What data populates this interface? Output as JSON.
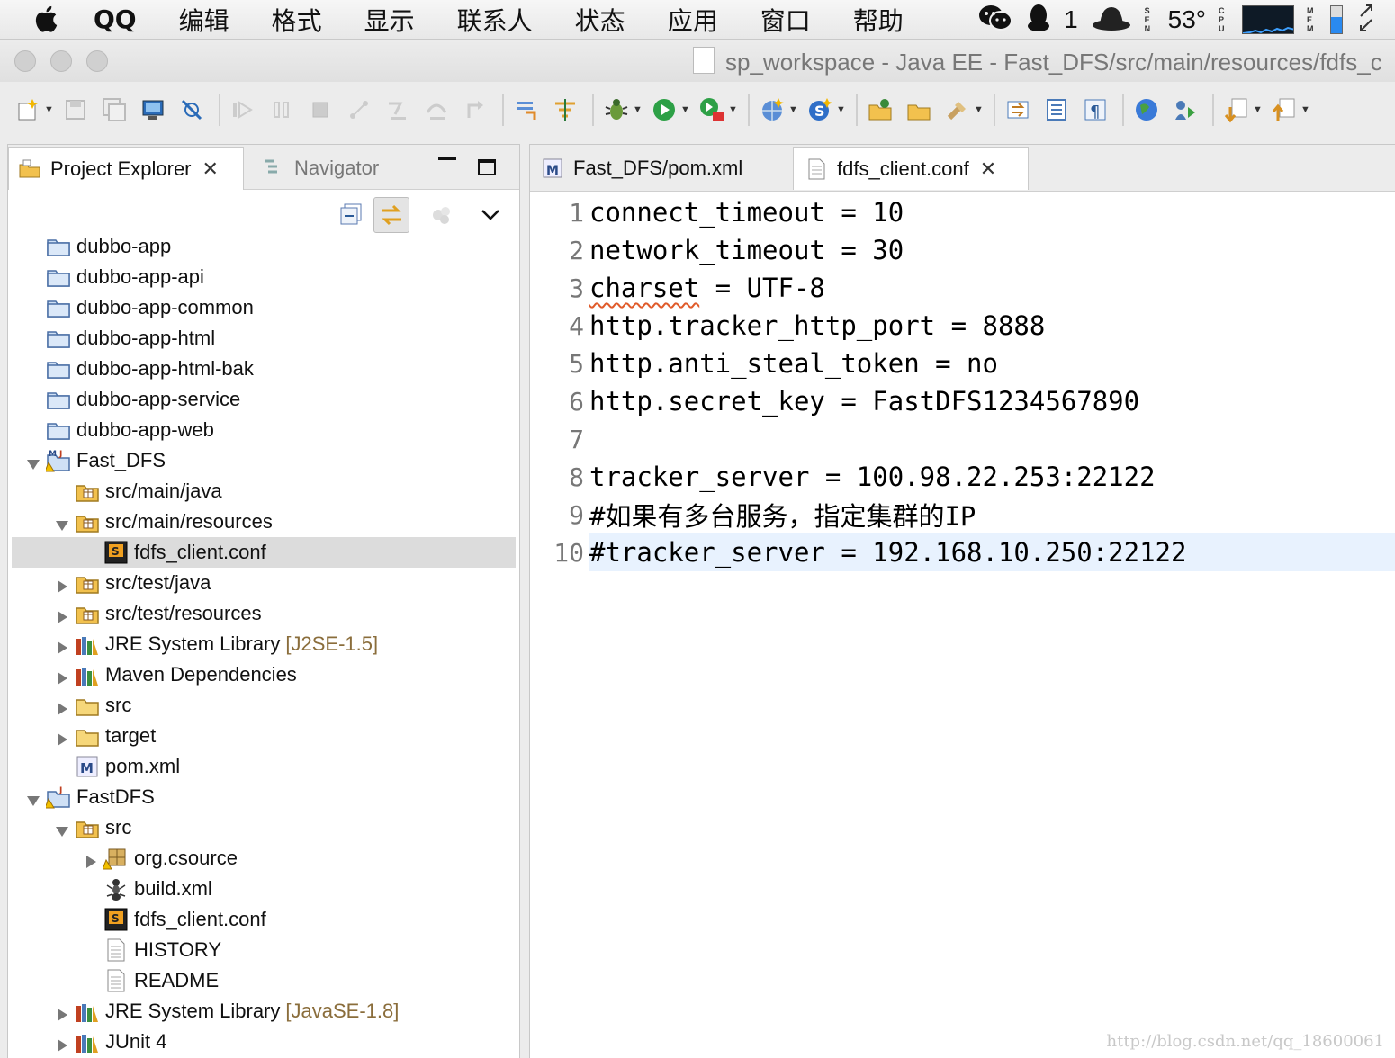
{
  "menubar": {
    "app_name": "QQ",
    "items": [
      "编辑",
      "格式",
      "显示",
      "联系人",
      "状态",
      "应用",
      "窗口",
      "帮助"
    ],
    "qq_count": "1",
    "temperature": "53°",
    "sensor_labels": {
      "sen": "S E N",
      "cpu": "C P U",
      "mem": "M E M"
    },
    "memory_usage": 0.6
  },
  "window": {
    "title": "sp_workspace - Java EE - Fast_DFS/src/main/resources/fdfs_c"
  },
  "explorer": {
    "tabs": [
      {
        "label": "Project Explorer",
        "active": true
      },
      {
        "label": "Navigator",
        "active": false
      }
    ],
    "tree": [
      {
        "label": "dubbo-app",
        "level": 0,
        "twisty": "none",
        "icon": "project-folder-icon"
      },
      {
        "label": "dubbo-app-api",
        "level": 0,
        "twisty": "none",
        "icon": "project-folder-icon"
      },
      {
        "label": "dubbo-app-common",
        "level": 0,
        "twisty": "none",
        "icon": "project-folder-icon"
      },
      {
        "label": "dubbo-app-html",
        "level": 0,
        "twisty": "none",
        "icon": "project-folder-icon"
      },
      {
        "label": "dubbo-app-html-bak",
        "level": 0,
        "twisty": "none",
        "icon": "project-folder-icon"
      },
      {
        "label": "dubbo-app-service",
        "level": 0,
        "twisty": "none",
        "icon": "project-folder-icon"
      },
      {
        "label": "dubbo-app-web",
        "level": 0,
        "twisty": "none",
        "icon": "project-folder-icon"
      },
      {
        "label": "Fast_DFS",
        "level": 0,
        "twisty": "open",
        "icon": "maven-project-icon"
      },
      {
        "label": "src/main/java",
        "level": 1,
        "twisty": "none",
        "icon": "source-folder-icon"
      },
      {
        "label": "src/main/resources",
        "level": 1,
        "twisty": "open",
        "icon": "source-folder-icon"
      },
      {
        "label": "fdfs_client.conf",
        "level": 2,
        "twisty": "none",
        "icon": "conf-file-icon",
        "selected": true
      },
      {
        "label": "src/test/java",
        "level": 1,
        "twisty": "closed",
        "icon": "source-folder-icon"
      },
      {
        "label": "src/test/resources",
        "level": 1,
        "twisty": "closed",
        "icon": "source-folder-icon"
      },
      {
        "label": "JRE System Library",
        "decor": "[J2SE-1.5]",
        "level": 1,
        "twisty": "closed",
        "icon": "library-icon"
      },
      {
        "label": "Maven Dependencies",
        "level": 1,
        "twisty": "closed",
        "icon": "library-icon"
      },
      {
        "label": "src",
        "level": 1,
        "twisty": "closed",
        "icon": "folder-icon"
      },
      {
        "label": "target",
        "level": 1,
        "twisty": "closed",
        "icon": "folder-icon"
      },
      {
        "label": "pom.xml",
        "level": 1,
        "twisty": "none",
        "icon": "maven-file-icon"
      },
      {
        "label": "FastDFS",
        "level": 0,
        "twisty": "open",
        "icon": "java-project-icon"
      },
      {
        "label": "src",
        "level": 1,
        "twisty": "open",
        "icon": "source-folder-icon"
      },
      {
        "label": "org.csource",
        "level": 2,
        "twisty": "closed",
        "icon": "package-icon"
      },
      {
        "label": "build.xml",
        "level": 2,
        "twisty": "none",
        "icon": "ant-file-icon"
      },
      {
        "label": "fdfs_client.conf",
        "level": 2,
        "twisty": "none",
        "icon": "conf-file-icon"
      },
      {
        "label": "HISTORY",
        "level": 2,
        "twisty": "none",
        "icon": "text-file-icon"
      },
      {
        "label": "README",
        "level": 2,
        "twisty": "none",
        "icon": "text-file-icon"
      },
      {
        "label": "JRE System Library",
        "decor": "[JavaSE-1.8]",
        "level": 1,
        "twisty": "closed",
        "icon": "library-icon"
      },
      {
        "label": "JUnit 4",
        "level": 1,
        "twisty": "closed",
        "icon": "library-icon"
      }
    ]
  },
  "editor": {
    "tabs": [
      {
        "label": "Fast_DFS/pom.xml",
        "active": false,
        "icon": "maven-file-icon"
      },
      {
        "label": "fdfs_client.conf",
        "active": true,
        "icon": "text-file-icon"
      }
    ],
    "lines": [
      {
        "num": "1",
        "text": "connect_timeout = 10"
      },
      {
        "num": "2",
        "text": "network_timeout = 30"
      },
      {
        "num": "3",
        "text": "charset = UTF-8",
        "squiggle": "charset"
      },
      {
        "num": "4",
        "text": "http.tracker_http_port = 8888"
      },
      {
        "num": "5",
        "text": "http.anti_steal_token = no"
      },
      {
        "num": "6",
        "text": "http.secret_key = FastDFS1234567890"
      },
      {
        "num": "7",
        "text": ""
      },
      {
        "num": "8",
        "text": "tracker_server = 100.98.22.253:22122"
      },
      {
        "num": "9",
        "text": "#如果有多台服务，指定集群的IP"
      },
      {
        "num": "10",
        "text": "#tracker_server = 192.168.10.250:22122",
        "current": true
      }
    ]
  },
  "watermark": "http://blog.csdn.net/qq_18600061",
  "colors": {
    "current_line": "#e8f2fe",
    "selection": "#dcdcdc",
    "decorator": "#8a6d3b",
    "squiggle": "#e05b2b"
  }
}
